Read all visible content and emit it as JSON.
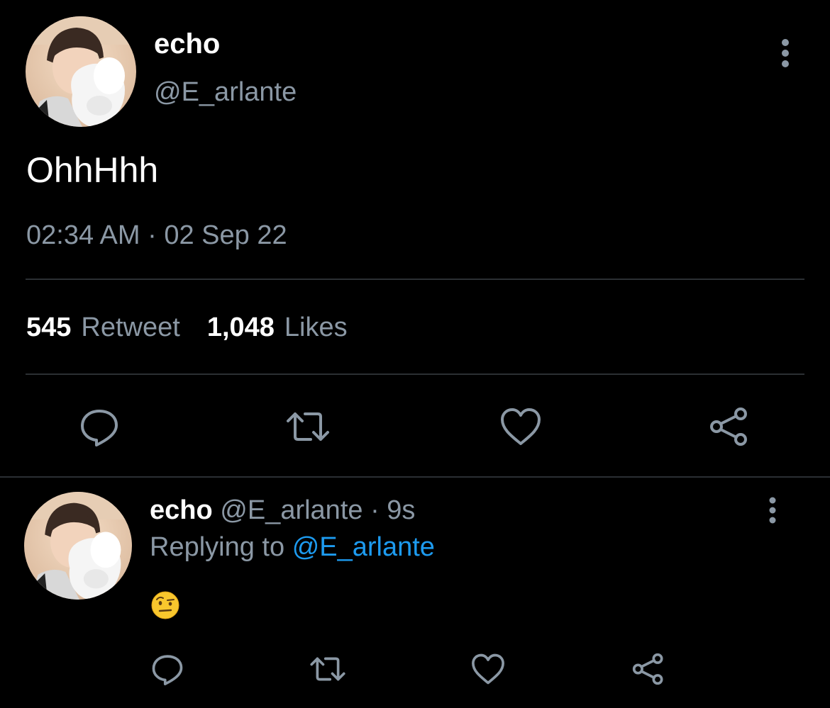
{
  "main_tweet": {
    "author_name": "echo",
    "author_handle": "@E_arlante",
    "text": "OhhHhh",
    "time": "02:34 AM",
    "separator": "·",
    "date": "02 Sep 22",
    "retweet_count": "545",
    "retweet_label": "Retweet",
    "like_count": "1,048",
    "like_label": "Likes",
    "actions": [
      "reply-icon",
      "retweet-icon",
      "like-icon",
      "share-icon"
    ],
    "more_icon": "more-vertical-icon"
  },
  "reply_tweet": {
    "author_name": "echo",
    "author_handle": "@E_arlante",
    "separator": "·",
    "age": "9s",
    "replying_prefix": "Replying to",
    "replying_to": "@E_arlante",
    "content_emoji": "face-with-raised-eyebrow",
    "actions": [
      "reply-icon",
      "retweet-icon",
      "like-icon",
      "share-icon"
    ],
    "more_icon": "more-vertical-icon"
  },
  "colors": {
    "background": "#000000",
    "primary_text": "#ffffff",
    "secondary_text": "#8b98a5",
    "link": "#1d9bf0",
    "divider": "#2b2f33"
  }
}
